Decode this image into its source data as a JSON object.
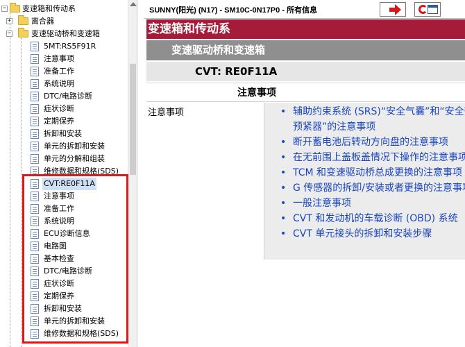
{
  "tree": {
    "items": [
      {
        "label": "变速箱和传动系",
        "level": 0,
        "type": "folder",
        "expanded": true
      },
      {
        "label": "离合器",
        "level": 1,
        "type": "folder",
        "expanded": false
      },
      {
        "label": "变速驱动桥和变速箱",
        "level": 1,
        "type": "folder",
        "expanded": true
      },
      {
        "label": "5MT:RS5F91R",
        "level": 2,
        "type": "doc"
      },
      {
        "label": "注意事项",
        "level": 2,
        "type": "doc"
      },
      {
        "label": "准备工作",
        "level": 2,
        "type": "doc"
      },
      {
        "label": "系统说明",
        "level": 2,
        "type": "doc"
      },
      {
        "label": "DTC/电路诊断",
        "level": 2,
        "type": "doc"
      },
      {
        "label": "症状诊断",
        "level": 2,
        "type": "doc"
      },
      {
        "label": "定期保养",
        "level": 2,
        "type": "doc"
      },
      {
        "label": "拆卸和安装",
        "level": 2,
        "type": "doc"
      },
      {
        "label": "单元的拆卸和安装",
        "level": 2,
        "type": "doc"
      },
      {
        "label": "单元的分解和组装",
        "level": 2,
        "type": "doc"
      },
      {
        "label": "维修数据和规格(SDS)",
        "level": 2,
        "type": "doc"
      },
      {
        "label": "CVT:RE0F11A",
        "level": 2,
        "type": "doc",
        "selected": true
      },
      {
        "label": "注意事项",
        "level": 2,
        "type": "doc"
      },
      {
        "label": "准备工作",
        "level": 2,
        "type": "doc"
      },
      {
        "label": "系统说明",
        "level": 2,
        "type": "doc"
      },
      {
        "label": "ECU诊断信息",
        "level": 2,
        "type": "doc"
      },
      {
        "label": "电路图",
        "level": 2,
        "type": "doc"
      },
      {
        "label": "基本检查",
        "level": 2,
        "type": "doc"
      },
      {
        "label": "DTC/电路诊断",
        "level": 2,
        "type": "doc"
      },
      {
        "label": "症状诊断",
        "level": 2,
        "type": "doc"
      },
      {
        "label": "定期保养",
        "level": 2,
        "type": "doc"
      },
      {
        "label": "拆卸和安装",
        "level": 2,
        "type": "doc"
      },
      {
        "label": "单元的拆卸和安装",
        "level": 2,
        "type": "doc"
      },
      {
        "label": "维修数据和规格(SDS)",
        "level": 2,
        "type": "doc"
      }
    ]
  },
  "topbar": {
    "title": "SUNNY(阳光) (N17) - SM10C-0N17P0 - 所有信息"
  },
  "content": {
    "section_title": "变速箱和传动系",
    "subsection_title": "变速驱动桥和变速箱",
    "model_title": "CVT: RE0F11A",
    "table_header": "注意事项",
    "row_label": "注意事项",
    "links": [
      "辅助约束系统 (SRS)“安全气囊”和“安全带预紧器”的注意事项",
      "断开蓄电池后转动方向盘的注意事项",
      "在无前围上盖板盖情况下操作的注意事项",
      "TCM 和变速驱动桥总成更换的注意事项",
      "G 传感器的拆卸/安装或者更换的注意事项",
      "一般注意事项",
      "CVT 和发动机的车载诊断 (OBD) 系统",
      "CVT 单元接头的拆卸和安装步骤"
    ]
  },
  "colors": {
    "section_band": "#a51c3a",
    "subsection_band": "#8f8f8f",
    "link": "#1a45c0",
    "highlight_box": "#e41515"
  }
}
